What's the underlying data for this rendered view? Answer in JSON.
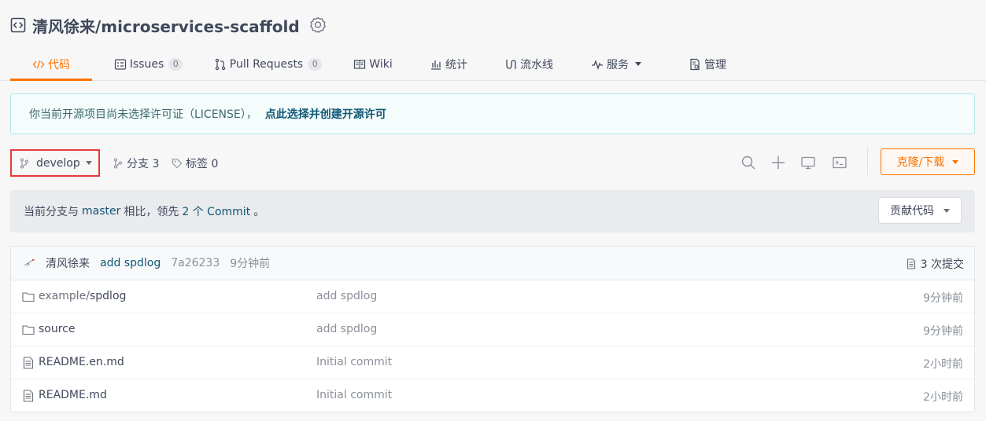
{
  "repo": {
    "title": "清风徐来/microservices-scaffold"
  },
  "tabs": [
    {
      "label": "代码",
      "icon": "code-icon",
      "active": true
    },
    {
      "label": "Issues",
      "icon": "issues-icon",
      "count": "0"
    },
    {
      "label": "Pull Requests",
      "icon": "pull-request-icon",
      "count": "0"
    },
    {
      "label": "Wiki",
      "icon": "wiki-icon"
    },
    {
      "label": "统计",
      "icon": "bar-chart-icon"
    },
    {
      "label": "流水线",
      "icon": "pipeline-icon"
    },
    {
      "label": "服务",
      "icon": "pulse-icon",
      "dropdown": true
    },
    {
      "label": "管理",
      "icon": "settings-doc-icon"
    }
  ],
  "notice": {
    "text": "你当前开源项目尚未选择许可证（LICENSE），",
    "link": "点此选择并创建开源许可"
  },
  "toolbar": {
    "branch": "develop",
    "branches_label": "分支 3",
    "tags_label": "标签 0",
    "clone_label": "克隆/下载",
    "icons": [
      "search-icon",
      "plus-icon",
      "monitor-icon",
      "terminal-icon"
    ]
  },
  "compare": {
    "prefix": "当前分支与",
    "base_branch": "master",
    "middle": "相比，领先",
    "commits": "2 个 Commit",
    "suffix": "。",
    "contribute_label": "贡献代码"
  },
  "last_commit": {
    "author": "清风徐来",
    "message": "add spdlog",
    "sha": "7a26233",
    "time": "9分钟前",
    "commit_count": "3 次提交"
  },
  "files": [
    {
      "type": "folder",
      "prefix": "example/",
      "name": "spdlog",
      "message": "add spdlog",
      "time": "9分钟前"
    },
    {
      "type": "folder",
      "prefix": "",
      "name": "source",
      "message": "add spdlog",
      "time": "9分钟前"
    },
    {
      "type": "file",
      "prefix": "",
      "name": "README.en.md",
      "message": "Initial commit",
      "time": "2小时前"
    },
    {
      "type": "file",
      "prefix": "",
      "name": "README.md",
      "message": "Initial commit",
      "time": "2小时前"
    }
  ],
  "colors": {
    "accent": "#fe7300",
    "link": "#0f5675",
    "highlight_border": "#e83a3a",
    "notice_bg": "#f4fcfc"
  }
}
